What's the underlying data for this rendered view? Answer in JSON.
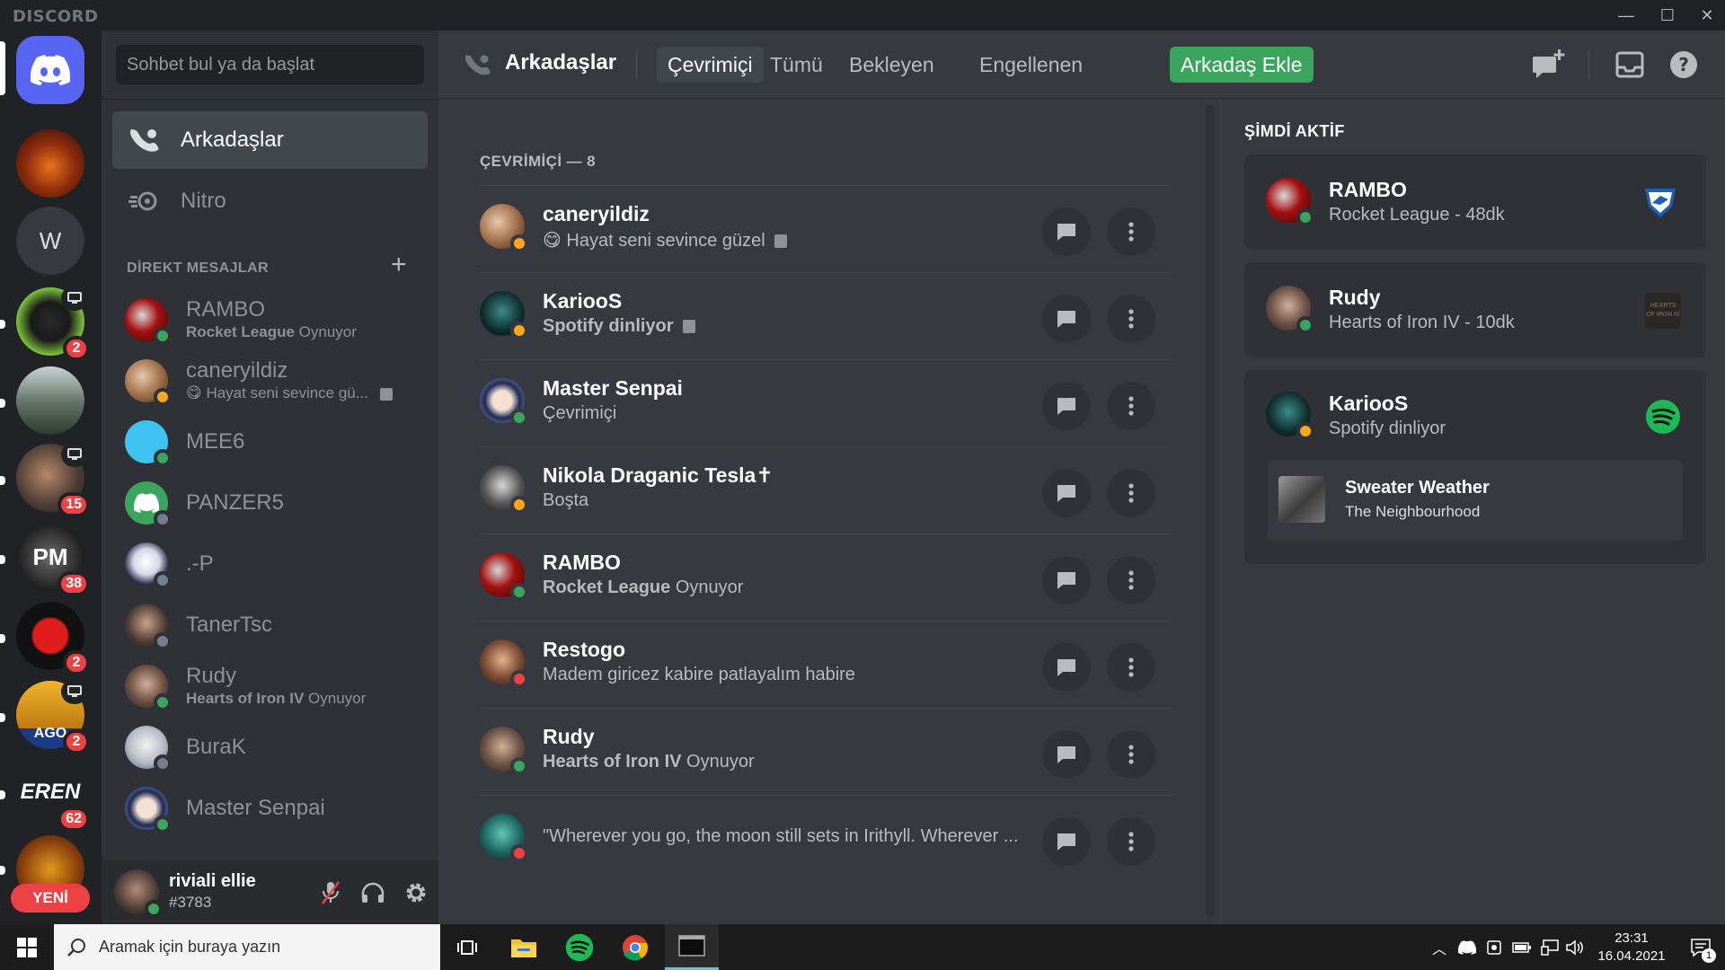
{
  "app": {
    "brand": "DISCORD"
  },
  "window": {
    "minimize": "—",
    "maximize": "☐",
    "close": "✕"
  },
  "rail": {
    "servers": [
      {
        "name": "server-fire",
        "badge": ""
      },
      {
        "name": "server-w",
        "initial": "W",
        "badge": ""
      },
      {
        "name": "server-wolf",
        "badge": "2"
      },
      {
        "name": "server-landscape",
        "badge": ""
      },
      {
        "name": "server-portrait",
        "badge": "15"
      },
      {
        "name": "server-pm",
        "badge": "38"
      },
      {
        "name": "server-devil",
        "badge": "2"
      },
      {
        "name": "server-ago",
        "badge": "2"
      },
      {
        "name": "server-eren",
        "badge": "62"
      },
      {
        "name": "server-tg",
        "badge": ""
      }
    ],
    "new_label": "YENİ"
  },
  "sidebar": {
    "search_placeholder": "Sohbet bul ya da başlat",
    "nav": {
      "friends": "Arkadaşlar",
      "nitro": "Nitro"
    },
    "dm_header": "DİREKT MESAJLAR",
    "dm_plus": "+",
    "dms": [
      {
        "name": "RAMBO",
        "sub_bold": "Rocket League",
        "sub": " Oynuyor",
        "status": "online"
      },
      {
        "name": "caneryildiz",
        "sub_bold": "",
        "sub": "😋 Hayat seni sevince gü...",
        "status": "idle"
      },
      {
        "name": "MEE6",
        "sub_bold": "",
        "sub": "",
        "status": "online"
      },
      {
        "name": "PANZER5",
        "sub_bold": "",
        "sub": "",
        "status": "off"
      },
      {
        "name": ".-P",
        "sub_bold": "",
        "sub": "",
        "status": "off"
      },
      {
        "name": "TanerTsc",
        "sub_bold": "",
        "sub": "",
        "status": "off"
      },
      {
        "name": "Rudy",
        "sub_bold": "Hearts of Iron IV",
        "sub": " Oynuyor",
        "status": "online"
      },
      {
        "name": "BuraK",
        "sub_bold": "",
        "sub": "",
        "status": "off"
      },
      {
        "name": "Master Senpai",
        "sub_bold": "",
        "sub": "",
        "status": "online"
      }
    ]
  },
  "user": {
    "name": "riviali ellie",
    "tag": "#3783"
  },
  "topbar": {
    "title": "Arkadaşlar",
    "tabs": [
      "Çevrimiçi",
      "Tümü",
      "Bekleyen",
      "Engellenen"
    ],
    "add_friend": "Arkadaş Ekle"
  },
  "friends": {
    "header": "ÇEVRİMİÇİ — 8",
    "items": [
      {
        "name": "caneryildiz",
        "sub_bold": "",
        "sub": "😋 Hayat seni sevince güzel",
        "status": "idle",
        "note": true
      },
      {
        "name": "KariooS",
        "sub_bold": "Spotify dinliyor",
        "sub": "",
        "status": "idle",
        "note": true
      },
      {
        "name": "Master Senpai",
        "sub_bold": "",
        "sub": "Çevrimiçi",
        "status": "online",
        "note": false
      },
      {
        "name": "Nikola Draganic Tesla✝",
        "sub_bold": "",
        "sub": "Boşta",
        "status": "idle",
        "note": false
      },
      {
        "name": "RAMBO",
        "sub_bold": "Rocket League",
        "sub": " Oynuyor",
        "status": "online",
        "note": false
      },
      {
        "name": "Restogo",
        "sub_bold": "",
        "sub": "Madem giricez kabire patlayalım habire",
        "status": "dnd",
        "note": false
      },
      {
        "name": "Rudy",
        "sub_bold": "Hearts of Iron IV",
        "sub": " Oynuyor",
        "status": "online",
        "note": false
      },
      {
        "name": "",
        "sub_bold": "",
        "sub": "\"Wherever you go, the moon still sets in Irithyll. Wherever ...",
        "status": "dnd",
        "note": false
      }
    ]
  },
  "active_now": {
    "header": "ŞİMDİ AKTİF",
    "cards": [
      {
        "name": "RAMBO",
        "sub": "Rocket League - 48dk"
      },
      {
        "name": "Rudy",
        "sub": "Hearts of Iron IV - 10dk",
        "game_art_text": "HEARTS OF IRON IV"
      },
      {
        "name": "KariooS",
        "sub": "Spotify dinliyor",
        "track": {
          "title": "Sweater Weather",
          "artist": "The Neighbourhood"
        }
      }
    ]
  },
  "taskbar": {
    "search_placeholder": "Aramak için buraya yazın",
    "time": "23:31",
    "date": "16.04.2021",
    "notif_count": "1"
  },
  "colors": {
    "accent": "#5865f2",
    "online": "#3ba55d",
    "idle": "#faa81a",
    "dnd": "#ed4245",
    "offline": "#747f8d",
    "spotify": "#1db954",
    "add_friend": "#3ba55d"
  }
}
